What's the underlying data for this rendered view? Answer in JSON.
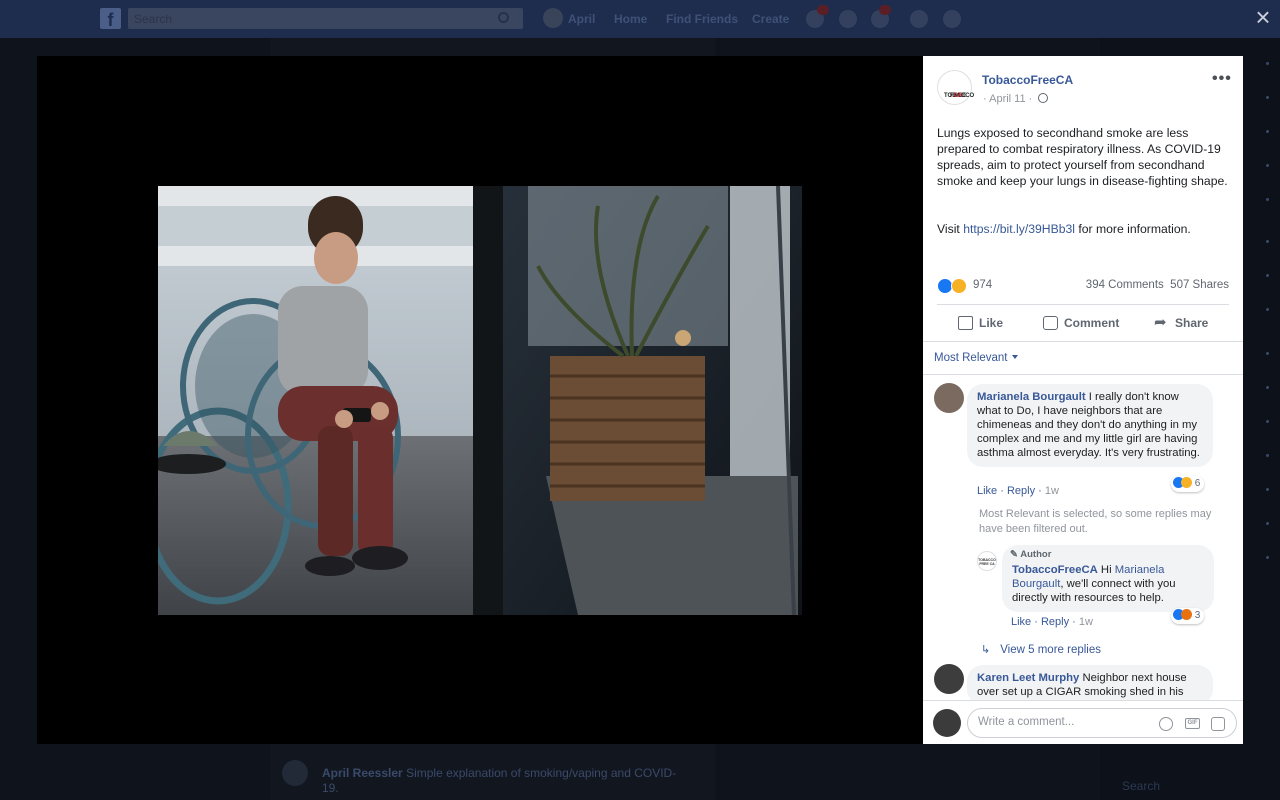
{
  "fb_header": {
    "search_placeholder": "Search",
    "user_name": "April",
    "nav": [
      "Home",
      "Find Friends",
      "Create"
    ]
  },
  "background": {
    "snippet_author": "April Reessler",
    "snippet_text": "Simple explanation of smoking/vaping and COVID-19.",
    "search_label": "Search"
  },
  "post": {
    "page_name": "TobaccoFreeCA",
    "avatar_text_1": "TOBACCO",
    "avatar_text_2": "FREE",
    "avatar_text_3": "CA",
    "date": "April 11",
    "more": "•••",
    "body": "Lungs exposed to secondhand smoke are less prepared to combat respiratory illness. As COVID-19 spreads, aim to protect yourself from secondhand smoke and keep your lungs in disease-fighting shape.",
    "visit_prefix": "Visit ",
    "link": "https://bit.ly/39HBb3l",
    "visit_suffix": " for more information.",
    "reaction_count": "974",
    "comments_count": "394 Comments",
    "shares_count": "507 Shares"
  },
  "actions": {
    "like": "Like",
    "comment": "Comment",
    "share": "Share"
  },
  "filter": {
    "label": "Most Relevant"
  },
  "comments": [
    {
      "author": "Marianela Bourgault",
      "text": " I really don't know what to Do, I have neighbors that are chimeneas and they don't do anything in my complex and me and my little girl are having asthma almost everyday. It's very frustrating.",
      "like": "Like",
      "reply": "Reply",
      "time": "1w",
      "reactions": "6"
    },
    {
      "author": "Karen Leet Murphy",
      "text": " Neighbor next house over set up a CIGAR smoking shed in his"
    }
  ],
  "filtered_note": "Most Relevant is selected, so some replies may have been filtered out.",
  "reply": {
    "author_tag": "Author",
    "author": "TobaccoFreeCA",
    "text_pre": " Hi ",
    "mention": "Marianela Bourgault",
    "text_post": ", we'll connect with you directly with resources to help.",
    "like": "Like",
    "reply": "Reply",
    "time": "1w",
    "reactions": "3",
    "avatar_text": "TOBACCO FREE CA"
  },
  "view_more": "View 5 more replies",
  "composer": {
    "placeholder": "Write a comment...",
    "gif_label": "GIF"
  },
  "close_symbol": "×",
  "colors": {
    "link": "#385898",
    "like_blue": "#1877f2",
    "sad_yellow": "#f7b125",
    "header_dim": "#1e2d4d"
  },
  "icons": [
    "facebook-logo-icon",
    "search-icon",
    "globe-icon",
    "more-icon",
    "like-icon",
    "comment-icon",
    "share-icon",
    "close-icon",
    "emoji-icon",
    "gif-icon",
    "sticker-icon",
    "pencil-icon",
    "reply-arrow-icon",
    "caret-down-icon"
  ]
}
